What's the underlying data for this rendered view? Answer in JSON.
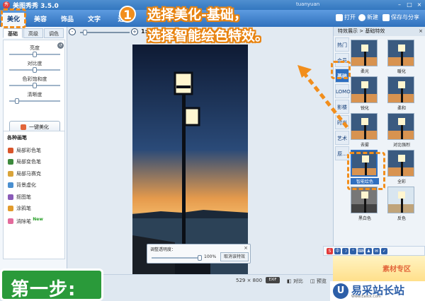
{
  "app": {
    "title": "美图秀秀 3.5.0",
    "logo_text": "秀",
    "user": "tuanyuan",
    "window_controls": [
      "–",
      "□",
      "×"
    ]
  },
  "tabs": [
    {
      "label": "美化",
      "active": true
    },
    {
      "label": "美容"
    },
    {
      "label": "饰品"
    },
    {
      "label": "文字"
    },
    {
      "label": "边"
    }
  ],
  "toolbar": {
    "open_label": "打开",
    "new_label": "新建",
    "save_share_label": "保存与分享"
  },
  "left_panel": {
    "subtabs": [
      "基础",
      "高级",
      "调色"
    ],
    "sliders": [
      {
        "label": "亮度",
        "value": 0.5
      },
      {
        "label": "对比度",
        "value": 0.5
      },
      {
        "label": "色彩饱和度",
        "value": 0.5
      },
      {
        "label": "清晰度",
        "value": 0.15
      }
    ],
    "one_click_label": "一键美化",
    "brushes_title": "各种画笔",
    "brushes": [
      {
        "label": "局部彩色笔",
        "color": "#d9552a"
      },
      {
        "label": "局部变色笔",
        "color": "#3d8a3d"
      },
      {
        "label": "局部马赛克",
        "color": "#d9a43a"
      },
      {
        "label": "背景虚化",
        "color": "#4a8fd0"
      },
      {
        "label": "抠图笔",
        "color": "#8a5bb8"
      },
      {
        "label": "涂鸦笔",
        "color": "#e29b2c"
      },
      {
        "label": "消除笔",
        "color": "#e36b9c",
        "badge": "New"
      }
    ]
  },
  "canvas": {
    "zoom_minus": "-",
    "zoom_plus": "+",
    "zoom_ratio": "1:1",
    "zoom_level": 0.1,
    "opacity_panel": {
      "label": "调整透明度：",
      "value_text": "100%",
      "level": 1.0,
      "cancel_label": "取消该特效",
      "close": "×"
    }
  },
  "status": {
    "size_text": "529 × 800",
    "exif": "EXIF",
    "compare_label": "对比",
    "preview_label": "预览"
  },
  "right_panel": {
    "header": "特效展示 > 基础特效",
    "header_close": "×",
    "categories": [
      {
        "label": "热门"
      },
      {
        "label": "会员"
      },
      {
        "label": "基础",
        "active": true
      },
      {
        "label": "LOMO"
      },
      {
        "label": "影楼"
      },
      {
        "label": "时尚"
      },
      {
        "label": "艺术"
      },
      {
        "label": "原..."
      }
    ],
    "effects": [
      {
        "label": "柔光"
      },
      {
        "label": "暖化"
      },
      {
        "label": "锐化"
      },
      {
        "label": "柔和"
      },
      {
        "label": "去雾"
      },
      {
        "label": "对比强烈"
      },
      {
        "label": "智能绘色",
        "selected": true
      },
      {
        "label": "全彩"
      },
      {
        "label": "黑白色"
      },
      {
        "label": "反色"
      }
    ]
  },
  "quick_bar": {
    "items": [
      "S",
      "中",
      "☽",
      "°",
      "⌨",
      "♟",
      "✉",
      "✓"
    ]
  },
  "ad": {
    "text": "素材专区"
  },
  "annotation": {
    "step_label": "第一步:",
    "callout_number": "1",
    "callout_line1": "选择美化-基础，",
    "callout_line2": "选择智能绘色特效。"
  },
  "watermark": {
    "logo": "U",
    "text": "易采站长站",
    "sub": "Www.Easck.Com"
  },
  "colors": {
    "titlebar": "#3377bf",
    "accent_orange": "#f28e1c",
    "step_green": "#2a9a3a",
    "selected_blue": "#2f6fc0"
  }
}
